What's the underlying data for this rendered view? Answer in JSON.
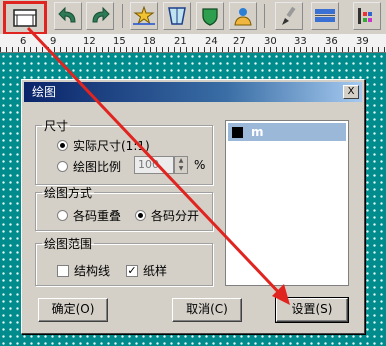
{
  "colors": {
    "background": "#008c8c",
    "titlebar": "#0a246a",
    "annotation": "#e0241f",
    "selected": "#9bb8d9"
  },
  "toolbar": {
    "icons": [
      "plot-frame-icon",
      "undo-icon",
      "redo-icon",
      "star-shape-icon",
      "trapezoid-icon",
      "shield-icon",
      "person-icon",
      "brush-icon",
      "pattern-icon",
      "color-grid-icon"
    ]
  },
  "ruler": {
    "labels": [
      "6",
      "9",
      "12",
      "15",
      "18",
      "21",
      "24",
      "27",
      "30",
      "33",
      "36",
      "39"
    ]
  },
  "dialog": {
    "title": "绘图",
    "close": "X",
    "size_group": {
      "legend": "尺寸",
      "actual_size": "实际尺寸(1:1)",
      "plot_scale": "绘图比例",
      "scale_value": "100",
      "percent": "%"
    },
    "mode_group": {
      "legend": "绘图方式",
      "overlap": "各码重叠",
      "separate": "各码分开"
    },
    "range_group": {
      "legend": "绘图范围",
      "structure_lines": "结构线",
      "paper_pattern": "纸样"
    },
    "list": {
      "items": [
        {
          "label": "m",
          "color": "#000000"
        }
      ]
    },
    "buttons": {
      "ok": "确定(O)",
      "cancel": "取消(C)",
      "settings": "设置(S)"
    }
  }
}
